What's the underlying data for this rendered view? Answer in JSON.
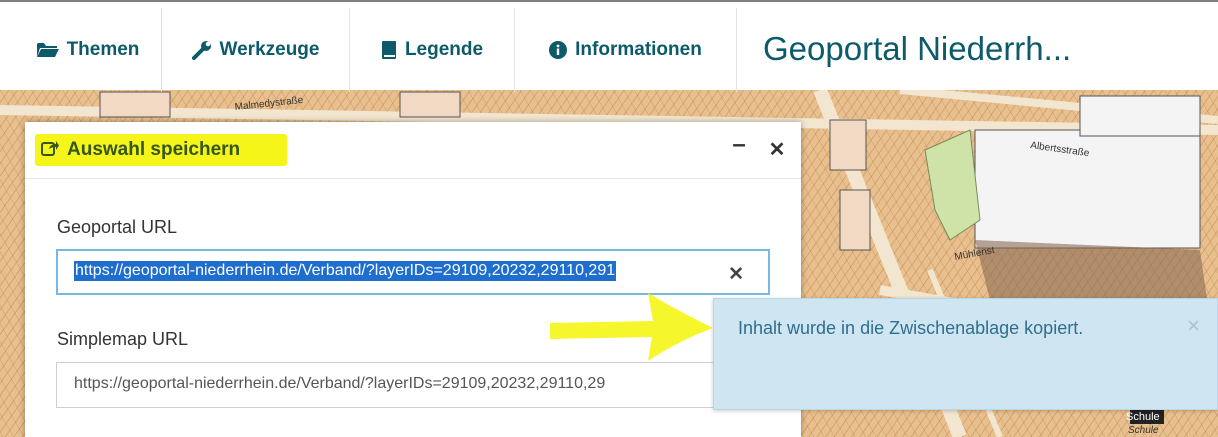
{
  "menu": {
    "items": [
      {
        "label": "Themen",
        "icon": "folder-open-icon"
      },
      {
        "label": "Werkzeuge",
        "icon": "wrench-icon"
      },
      {
        "label": "Legende",
        "icon": "book-icon"
      },
      {
        "label": "Informationen",
        "icon": "info-circle-icon"
      }
    ],
    "title": "Geoportal Niederrh..."
  },
  "map": {
    "street_labels": [
      "Malmedystraße",
      "Albertsstraße",
      "Mühlenst",
      "Schule",
      "Schule"
    ]
  },
  "dialog": {
    "title": "Auswahl speichern",
    "minimize_symbol": "–",
    "close_symbol": "✕",
    "geoportal_label": "Geoportal URL",
    "geoportal_value": "https://geoportal-niederrhein.de/Verband/?layerIDs=29109,20232,29110,291",
    "clear_symbol": "✕",
    "simplemap_label": "Simplemap URL",
    "simplemap_value": "https://geoportal-niederrhein.de/Verband/?layerIDs=29109,20232,29110,29"
  },
  "toast": {
    "message": "Inhalt wurde in die Zwischenablage kopiert.",
    "close_symbol": "×"
  },
  "colors": {
    "accent": "#0c5a6a",
    "highlight": "#f5f51a",
    "toast_bg": "#cfe6f2",
    "selection": "#1e6ecf"
  }
}
